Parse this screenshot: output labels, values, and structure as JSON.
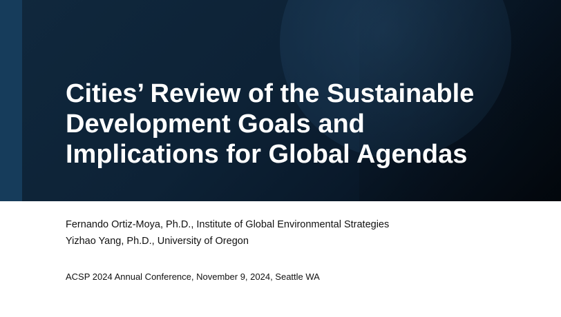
{
  "slide": {
    "title_lines": [
      "Cities’ Review of the Sustainable",
      "Development Goals and",
      "Implications for Global Agendas"
    ],
    "authors": [
      "Fernando Ortiz-Moya, Ph.D., Institute of Global Environmental Strategies",
      "Yizhao Yang, Ph.D., University of Oregon"
    ],
    "conference": "ACSP 2024 Annual Conference, November 9, 2024, Seattle WA"
  },
  "colors": {
    "header_background": "#0d2236",
    "accent_strip": "#163c5b",
    "title_text": "#ffffff",
    "body_text": "#111111"
  }
}
